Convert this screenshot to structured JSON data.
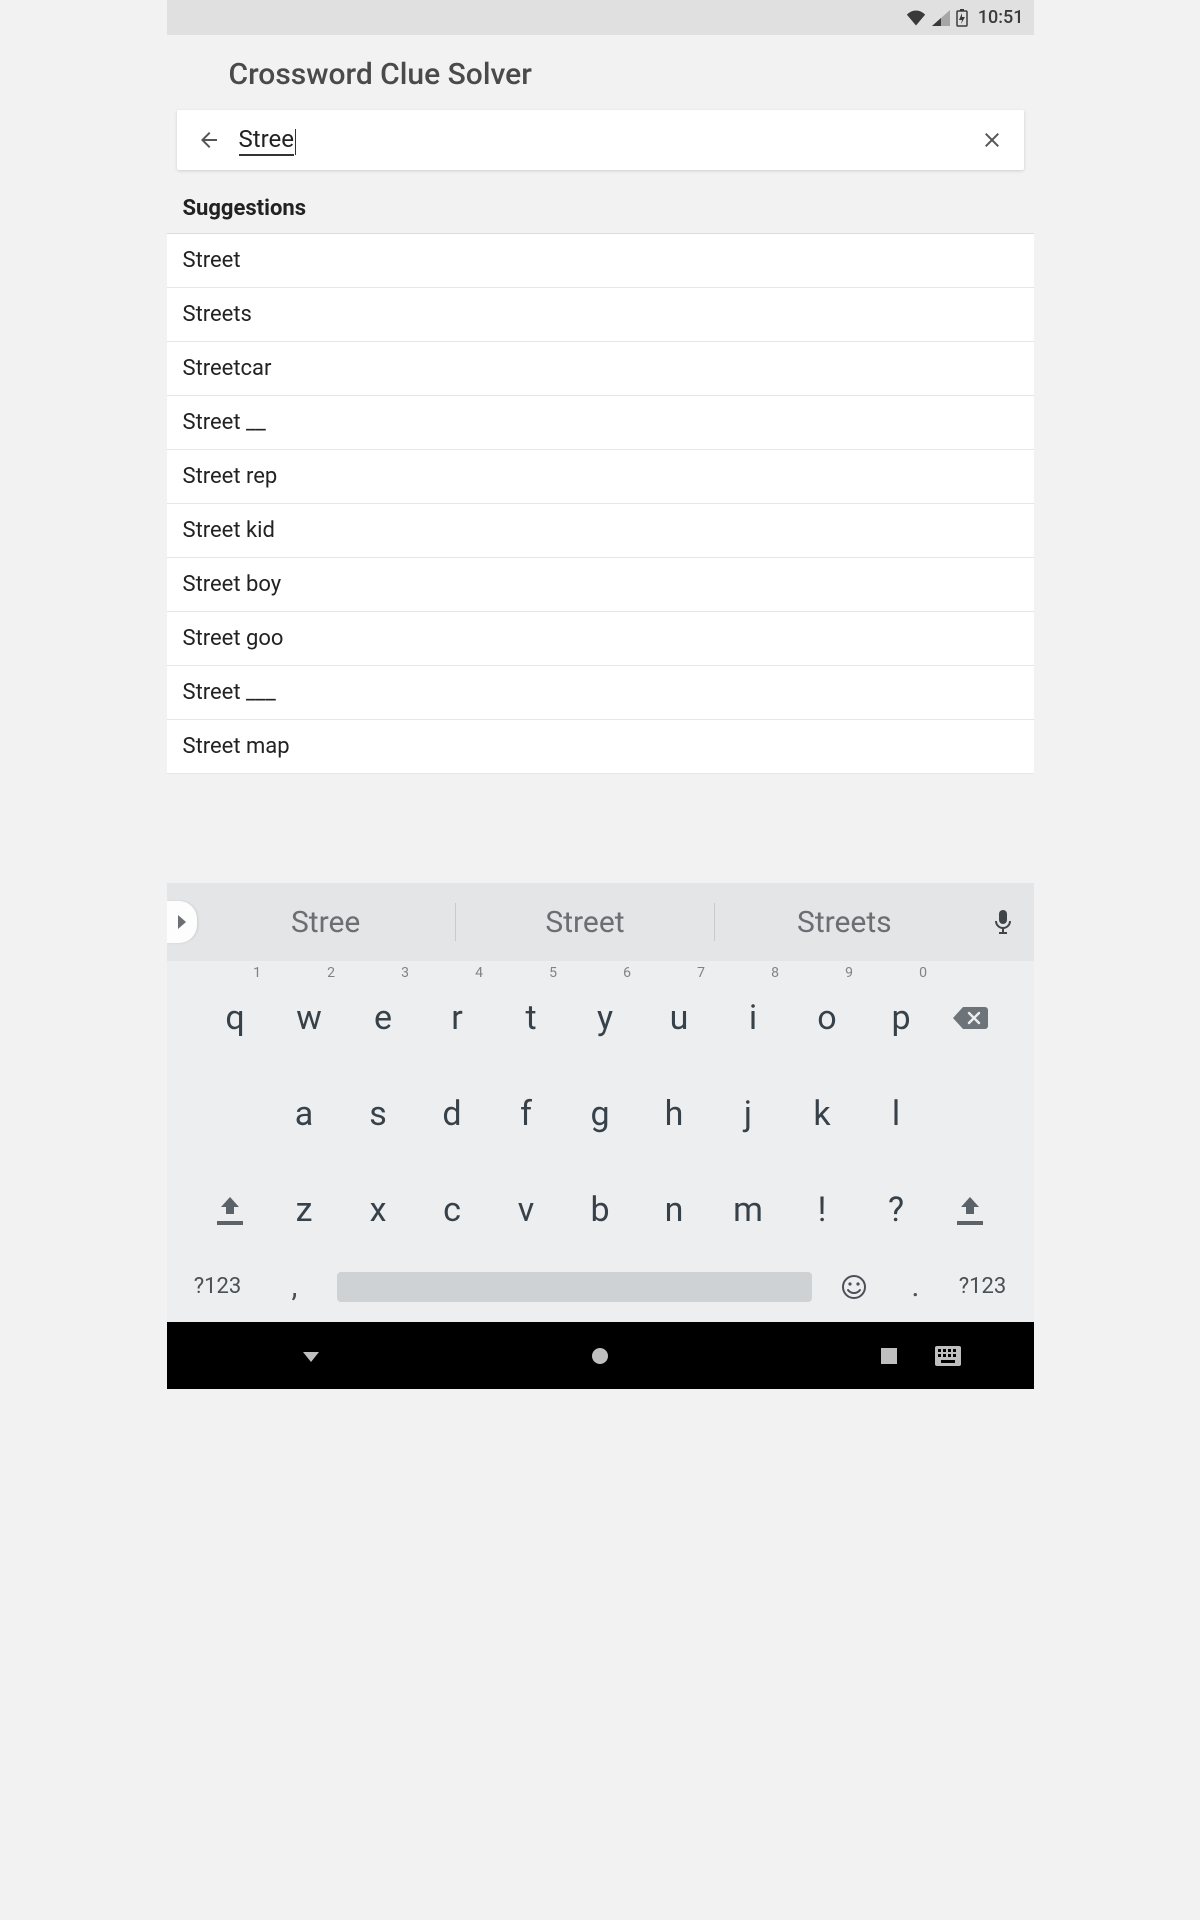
{
  "status": {
    "time": "10:51"
  },
  "header": {
    "title": "Crossword Clue Solver"
  },
  "search": {
    "value": "Stree"
  },
  "suggestions": {
    "header": "Suggestions",
    "items": [
      "Street",
      "Streets",
      "Streetcar",
      "Street __",
      "Street rep",
      "Street kid",
      "Street boy",
      "Street goo",
      "Street ___",
      "Street map"
    ]
  },
  "keyboard": {
    "predictions": [
      "Stree",
      "Street",
      "Streets"
    ],
    "row1": [
      {
        "k": "q",
        "n": "1"
      },
      {
        "k": "w",
        "n": "2"
      },
      {
        "k": "e",
        "n": "3"
      },
      {
        "k": "r",
        "n": "4"
      },
      {
        "k": "t",
        "n": "5"
      },
      {
        "k": "y",
        "n": "6"
      },
      {
        "k": "u",
        "n": "7"
      },
      {
        "k": "i",
        "n": "8"
      },
      {
        "k": "o",
        "n": "9"
      },
      {
        "k": "p",
        "n": "0"
      }
    ],
    "row2": [
      "a",
      "s",
      "d",
      "f",
      "g",
      "h",
      "j",
      "k",
      "l"
    ],
    "row3": [
      "z",
      "x",
      "c",
      "v",
      "b",
      "n",
      "m",
      "!",
      "?"
    ],
    "sym": "?123",
    "comma": ",",
    "dot": "."
  }
}
